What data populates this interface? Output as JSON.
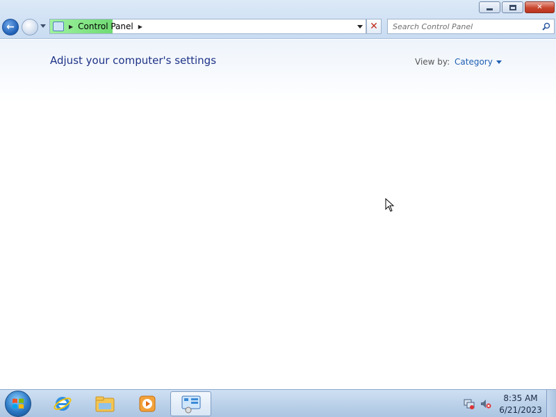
{
  "window": {
    "address": {
      "crumb": "Control Panel"
    },
    "search": {
      "placeholder": "Search Control Panel"
    }
  },
  "content": {
    "heading": "Adjust your computer's settings",
    "view_by_label": "View by:",
    "view_by_value": "Category"
  },
  "taskbar": {
    "clock_time": "8:35 AM",
    "clock_date": "6/21/2023",
    "pinned": [
      "internet-explorer-icon",
      "windows-explorer-icon",
      "media-player-icon",
      "control-panel-icon"
    ]
  },
  "colors": {
    "heading": "#1e3287",
    "link": "#1e5fb3",
    "close_button": "#c9472f"
  }
}
